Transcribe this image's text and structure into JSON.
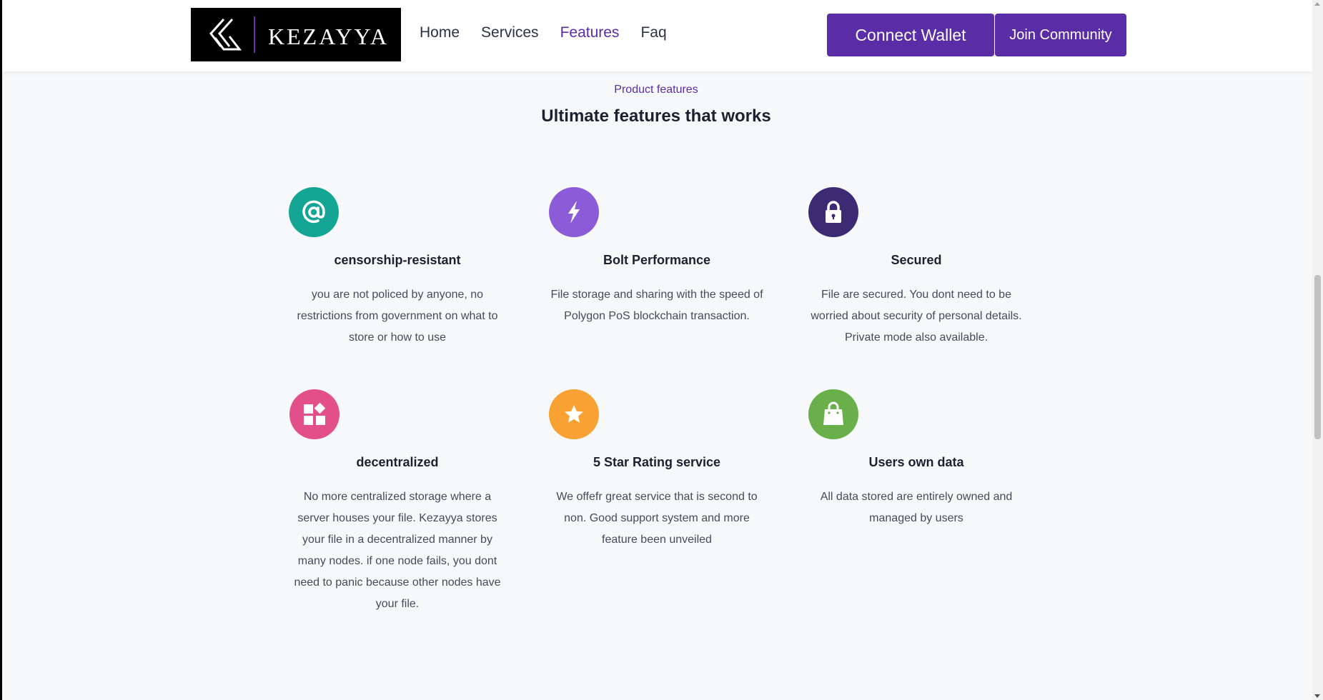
{
  "header": {
    "logo_text": "KEZAYYA",
    "nav": [
      {
        "label": "Home",
        "active": false
      },
      {
        "label": "Services",
        "active": false
      },
      {
        "label": "Features",
        "active": true
      },
      {
        "label": "Faq",
        "active": false
      }
    ],
    "connect_wallet_label": "Connect Wallet",
    "join_community_label": "Join Community"
  },
  "section": {
    "eyebrow": "Product features",
    "title": "Ultimate features that works"
  },
  "features": [
    {
      "icon": "at-sign-icon",
      "color": "#14a594",
      "title": "censorship-resistant",
      "description": "you are not policed by anyone, no restrictions from government on what to store or how to use"
    },
    {
      "icon": "bolt-icon",
      "color": "#8c5bd8",
      "title": "Bolt Performance",
      "description": "File storage and sharing with the speed of Polygon PoS blockchain transaction."
    },
    {
      "icon": "lock-icon",
      "color": "#3c2a74",
      "title": "Secured",
      "description": "File are secured. You dont need to be worried about security of personal details. Private mode also available."
    },
    {
      "icon": "widgets-icon",
      "color": "#e34f89",
      "title": "decentralized",
      "description": "No more centralized storage where a server houses your file. Kezayya stores your file in a decentralized manner by many nodes. if one node fails, you dont need to panic because other nodes have your file."
    },
    {
      "icon": "star-icon",
      "color": "#f9a233",
      "title": "5 Star Rating service",
      "description": "We offefr great service that is second to non. Good support system and more feature been unveiled"
    },
    {
      "icon": "shopping-bag-icon",
      "color": "#69b04a",
      "title": "Users own data",
      "description": "All data stored are entirely owned and managed by users"
    }
  ],
  "colors": {
    "brand_purple": "#5a2da7",
    "background": "#f7f8fa"
  }
}
